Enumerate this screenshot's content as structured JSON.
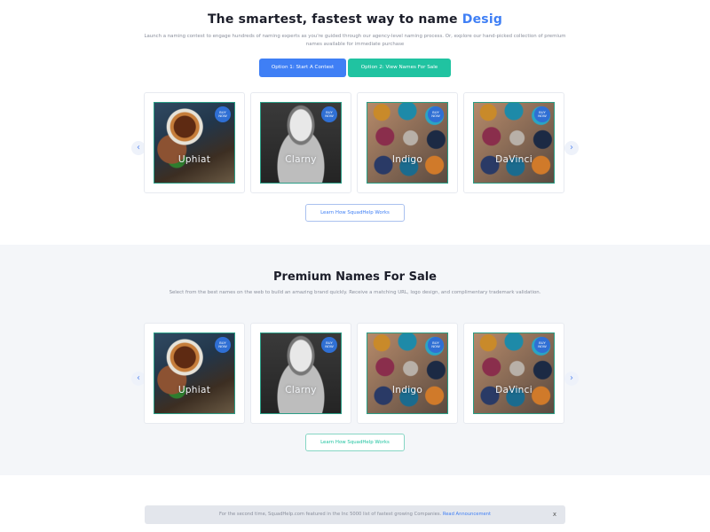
{
  "hero": {
    "title_prefix": "The smartest, fastest way to name ",
    "title_accent": "Desig",
    "description": "Launch a naming contest to engage hundreds of naming experts as you're guided through our agency-level naming process. Or, explore our hand-picked collection of premium names available for immediate purchase",
    "option1_label": "Option 1: Start A Contest",
    "option2_label": "Option 2: View Names For Sale",
    "learn_more_label": "Learn How SquadHelp Works"
  },
  "carousel_cards": [
    {
      "name": "Uphiat",
      "badge": "BUY NOW",
      "image": "coffee-food"
    },
    {
      "name": "Clarny",
      "badge": "BUY NOW",
      "image": "astronaut"
    },
    {
      "name": "Indigo",
      "badge": "BUY NOW",
      "image": "paint-pots"
    },
    {
      "name": "DaVinci",
      "badge": "BUY NOW",
      "image": "paint-pots"
    }
  ],
  "premium": {
    "title": "Premium Names For Sale",
    "description": "Select from the best names on the web to build an amazing brand quickly. Receive a matching URL, logo design, and complimentary trademark validation.",
    "learn_more_label": "Learn How SquadHelp Works"
  },
  "announcement": {
    "text": "For the second time, SquadHelp.com featured in the Inc 5000 list of fastest growing Companies. ",
    "link": "Read Announcement",
    "close": "x"
  },
  "icons": {
    "prev": "chevron-left-icon",
    "next": "chevron-right-icon"
  },
  "colors": {
    "primary_blue": "#3f7ff5",
    "primary_green": "#20c3a1",
    "section_bg": "#f4f6f9"
  }
}
